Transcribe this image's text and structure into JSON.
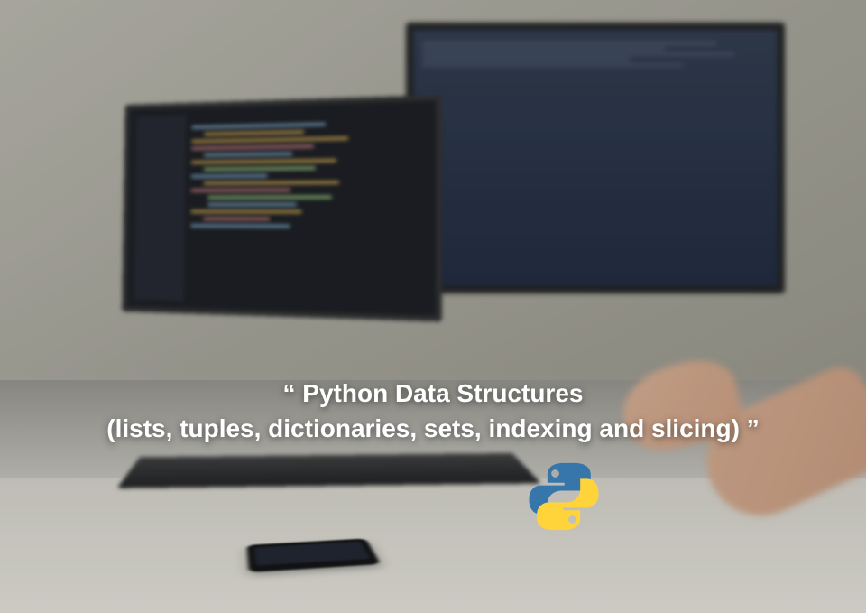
{
  "title": {
    "quote_open": "“ ",
    "line1": "Python Data Structures",
    "line2": "(lists, tuples, dictionaries, sets, indexing and slicing)",
    "quote_close": " ”"
  },
  "logo": {
    "name": "python-logo"
  }
}
